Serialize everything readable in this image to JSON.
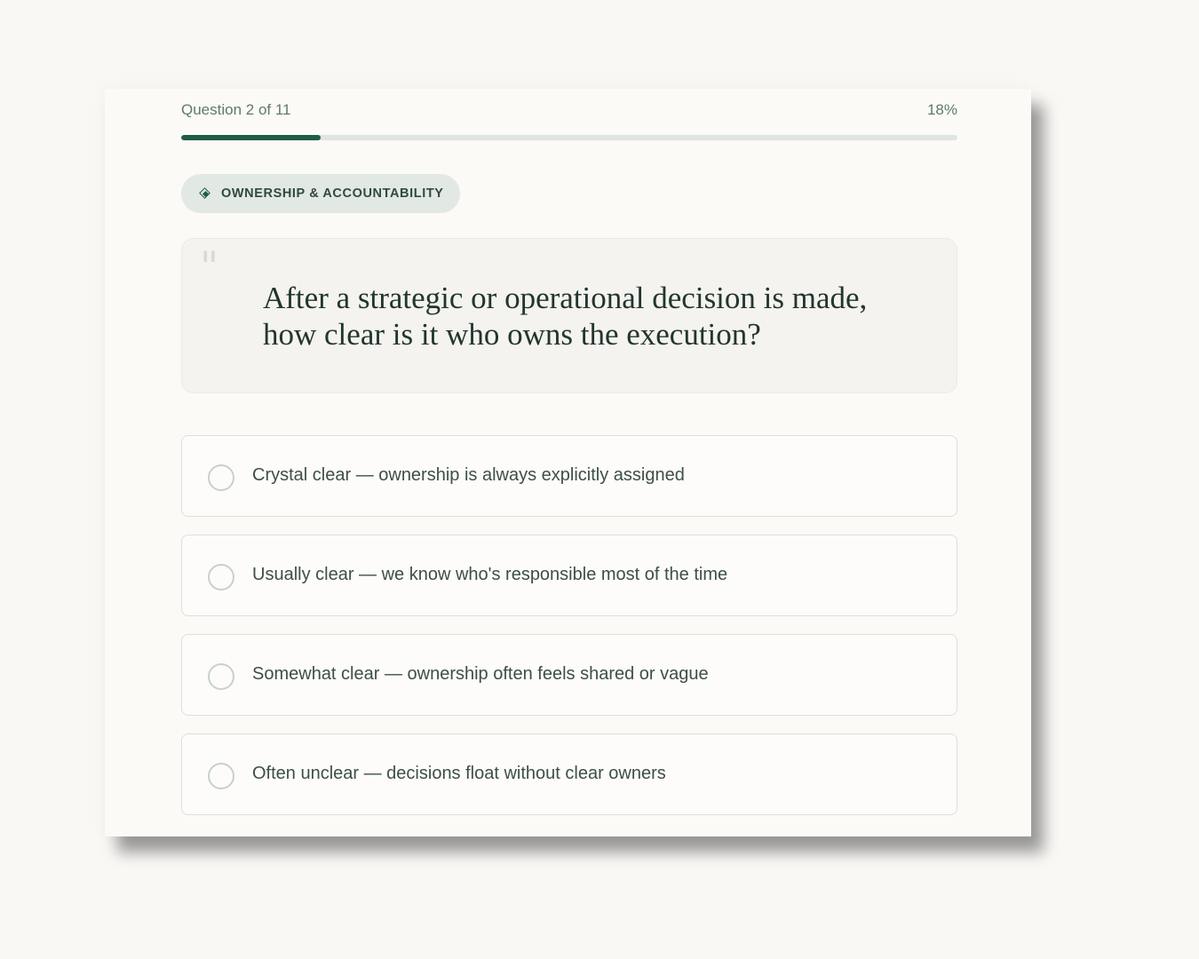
{
  "progress": {
    "question_label": "Question 2 of 11",
    "percent_label": "18%",
    "value": 0.18
  },
  "category": {
    "icon": "diamond-icon",
    "label": "OWNERSHIP & ACCOUNTABILITY"
  },
  "question": {
    "quote_icon": "quote-icon",
    "line1": "After a strategic or operational decision is made,",
    "line2": "how clear is it who owns the execution?"
  },
  "options": [
    {
      "label": "Crystal clear — ownership is always explicitly assigned"
    },
    {
      "label": "Usually clear — we know who's responsible most of the time"
    },
    {
      "label": "Somewhat clear — ownership often feels shared or vague"
    },
    {
      "label": "Often unclear — decisions float without clear owners"
    }
  ],
  "colors": {
    "accent": "#1f5c47",
    "track": "#dfe5e1",
    "pill_bg": "#e2e8e3",
    "text_dark": "#22362d"
  }
}
